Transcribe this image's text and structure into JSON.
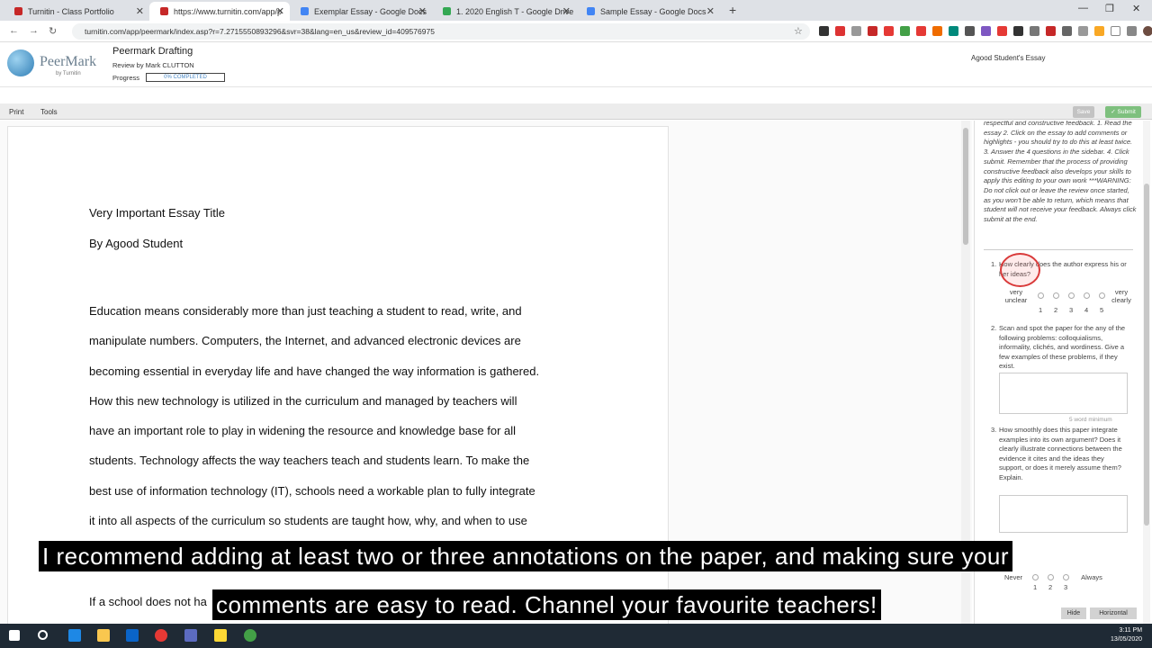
{
  "browser": {
    "tabs": [
      {
        "title": "Turnitin - Class Portfolio",
        "color": "#c62828"
      },
      {
        "title": "https://www.turnitin.com/app/p",
        "color": "#c62828"
      },
      {
        "title": "Exemplar Essay - Google Docs",
        "color": "#4285f4"
      },
      {
        "title": "1. 2020 English T - Google Drive",
        "color": "#34a853"
      },
      {
        "title": "Sample Essay - Google Docs",
        "color": "#4285f4"
      }
    ],
    "active_tab": 1,
    "url": "turnitin.com/app/peermark/index.asp?r=7.2715550893296&svr=38&lang=en_us&review_id=409576975"
  },
  "header": {
    "logo_text": "PeerMark",
    "logo_sub": "by Turnitin",
    "title": "Peermark Drafting",
    "review_by": "Review by Mark CLUTTON",
    "progress_label": "Progress",
    "progress_text": "0% COMPLETED",
    "progress_value": 0,
    "student": "Agood Student's Essay"
  },
  "toolbar": {
    "print": "Print",
    "tools": "Tools",
    "save": "Save",
    "submit": "Submit"
  },
  "essay": {
    "title": "Very Important Essay Title",
    "author": "By Agood Student",
    "paragraph": "Education means considerably more than just teaching a student to read, write, and\nmanipulate numbers. Computers, the Internet, and advanced electronic devices are\nbecoming essential in everyday life and have changed the way information is gathered.\nHow this new technology is utilized in the curriculum and managed by teachers will\nhave an important role to play in widening the resource and knowledge base for all\nstudents. Technology affects the way teachers teach and students learn. To make the\nbest use of information technology (IT), schools need a workable plan to fully integrate\nit into all aspects of the curriculum so students are taught how, why, and when to use",
    "partial_line": "If a school does not ha"
  },
  "sidebar": {
    "instructions": "respectful and constructive feedback. 1. Read the essay 2. Click on the essay to add comments or highlights - you should try to do this at least twice. 3. Answer the 4 questions in the sidebar. 4. Click submit. Remember that the process of providing constructive feedback also develops your skills to apply this editing to your own work ***WARNING: Do not click out or leave the review once started, as you won't be able to return, which means that student will not receive your feedback. Always click submit at the end.",
    "q1": {
      "num": "1.",
      "text": "How clearly does the author express his or her ideas?",
      "low": "very unclear",
      "high": "very clearly",
      "scale": [
        "1",
        "2",
        "3",
        "4",
        "5"
      ]
    },
    "q2": {
      "num": "2.",
      "text": "Scan and spot the paper for the any of the following problems: colloquialisms, informality, clichés, and wordiness. Give a few examples of these problems, if they exist.",
      "min": "5 word minimum"
    },
    "q3": {
      "num": "3.",
      "text": "How smoothly does this paper integrate examples into its own argument? Does it clearly illustrate connections between the evidence it cites and the ideas they support, or does it merely assume them? Explain."
    },
    "q4": {
      "low": "Never",
      "high": "Always",
      "scale": [
        "1",
        "2",
        "3"
      ]
    },
    "hide": "Hide",
    "horizontal": "Horizontal"
  },
  "captions": {
    "line1": "I recommend adding at least two or three annotations on the paper, and making sure your",
    "line2": "comments are easy to read. Channel your favourite teachers!"
  },
  "taskbar": {
    "time": "3:11 PM",
    "date": "13/05/2020"
  }
}
